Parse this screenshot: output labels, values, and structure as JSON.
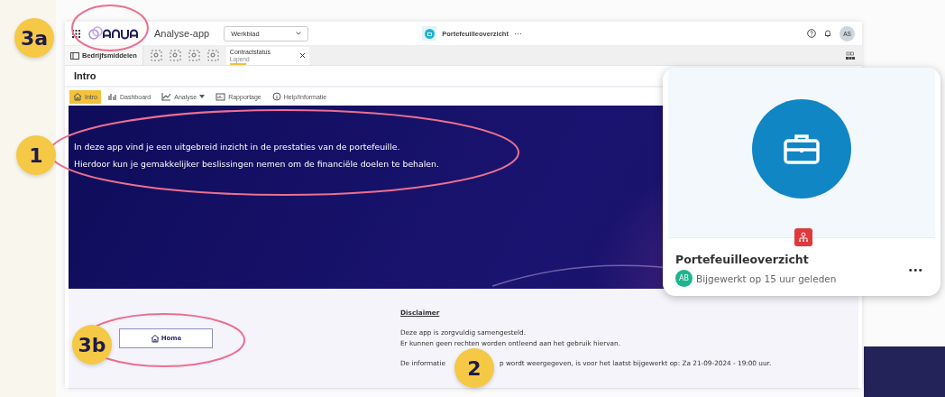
{
  "app": {
    "name": "Analyse-app",
    "sheet_dropdown": "Werkblad",
    "document_title": "Portefeuilleoverzicht",
    "more": "···",
    "avatar": "AS"
  },
  "toolbar": {
    "panel_label": "Bedrijfsmiddelen",
    "filter_chip": {
      "title": "Contractstatus",
      "value": "Lopend"
    }
  },
  "sheet_title": "Intro",
  "tabs": [
    {
      "label": "Intro",
      "kind": "home",
      "selected": true
    },
    {
      "label": "Dashboard",
      "kind": "dashboard",
      "selected": false
    },
    {
      "label": "Analyse",
      "kind": "chart",
      "selected": false
    },
    {
      "label": "Rapportage",
      "kind": "report",
      "selected": false
    },
    {
      "label": "Help/Informatie",
      "kind": "info",
      "selected": false
    }
  ],
  "hero": {
    "lines": [
      "In deze app vind je een uitgebreid inzicht in de prestaties van de portefeuille.",
      "Hierdoor kun je gemakkelijker beslissingen nemen om de financiële doelen te behalen."
    ]
  },
  "home_button": "Home",
  "disclaimer": {
    "heading": "Disclaimer",
    "lines": [
      "Deze app is zorgvuldig samengesteld.",
      "Er kunnen geen rechten worden ontleend aan het gebruik hiervan."
    ],
    "update_note_start": "De informatie",
    "update_note_end": "p wordt weergegeven, is voor het laatst bijgewerkt op: Za 21-09-2024 - 19:00 uur."
  },
  "card": {
    "title": "Portefeuilleoverzicht",
    "avatar": "AB",
    "updated": "Bijgewerkt op 15 uur geleden",
    "more": "•••"
  },
  "annotations": [
    {
      "label": "3a"
    },
    {
      "label": "1"
    },
    {
      "label": "3b"
    },
    {
      "label": "2"
    }
  ]
}
